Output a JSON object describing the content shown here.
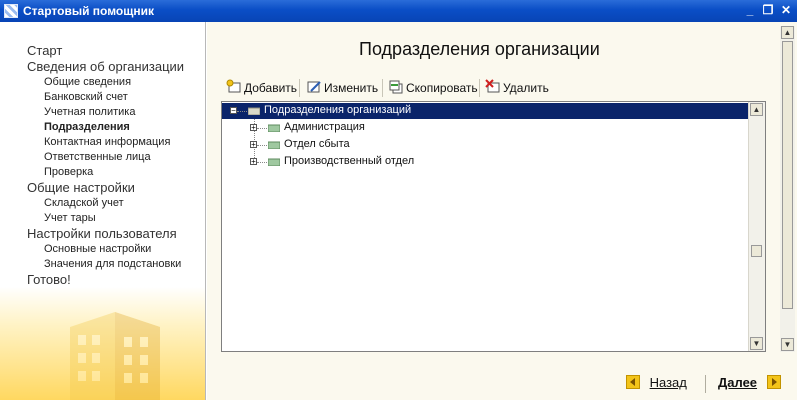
{
  "window": {
    "title": "Стартовый помощник"
  },
  "sidebar": {
    "items": [
      {
        "label": "Старт",
        "level": 1
      },
      {
        "label": "Сведения об организации",
        "level": 1
      },
      {
        "label": "Общие сведения",
        "level": 2
      },
      {
        "label": "Банковский счет",
        "level": 2
      },
      {
        "label": "Учетная политика",
        "level": 2
      },
      {
        "label": "Подразделения",
        "level": 2,
        "active": true
      },
      {
        "label": "Контактная информация",
        "level": 2
      },
      {
        "label": "Ответственные лица",
        "level": 2
      },
      {
        "label": "Проверка",
        "level": 2
      },
      {
        "label": "Общие настройки",
        "level": 1
      },
      {
        "label": "Складской учет",
        "level": 2
      },
      {
        "label": "Учет тары",
        "level": 2
      },
      {
        "label": "Настройки пользователя",
        "level": 1
      },
      {
        "label": "Основные настройки",
        "level": 2
      },
      {
        "label": "Значения для подстановки",
        "level": 2
      },
      {
        "label": "Готово!",
        "level": 1
      }
    ]
  },
  "main": {
    "title": "Подразделения организации",
    "toolbar": {
      "add_label": "Добавить",
      "edit_label": "Изменить",
      "copy_label": "Скопировать",
      "delete_label": "Удалить"
    },
    "tree": {
      "root_label": "Подразделения организаций",
      "children": [
        "Администрация",
        "Отдел сбыта",
        "Производственный отдел"
      ]
    }
  },
  "footer": {
    "back_label": "Назад",
    "next_label": "Далее"
  },
  "colors": {
    "titlebar": "#0a4ec6",
    "selection": "#0a246a",
    "nav_arrow": "#f3c419"
  }
}
